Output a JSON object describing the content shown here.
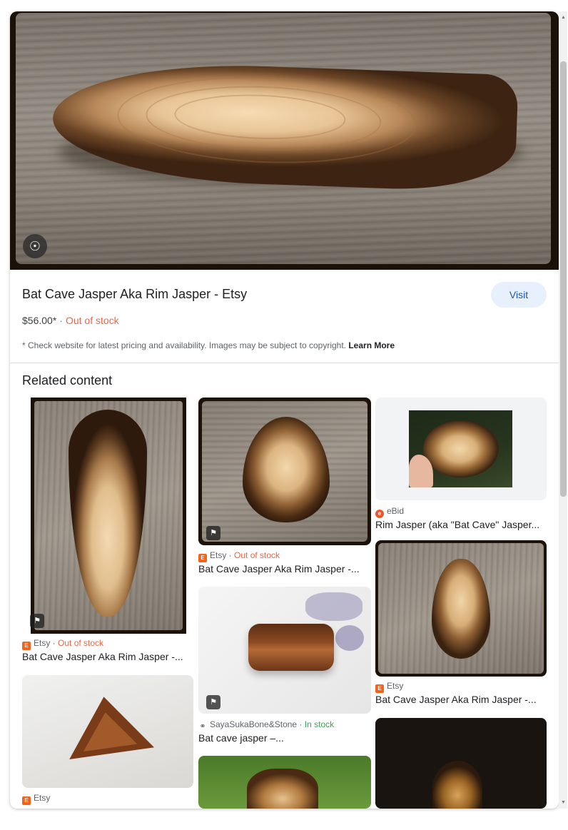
{
  "hero": {
    "lens_icon": "lens-icon",
    "title": "Bat Cave Jasper Aka Rim Jasper - Etsy",
    "visit_label": "Visit",
    "price": "$56.00*",
    "separator": "·",
    "stock": "Out of stock",
    "disclaimer": "* Check website for latest pricing and availability. Images may be subject to copyright.",
    "learn_more": "Learn More"
  },
  "related": {
    "heading": "Related content",
    "cards": [
      {
        "source": "Etsy",
        "sep": " · ",
        "stock": "Out of stock",
        "title": "Bat Cave Jasper Aka Rim Jasper -..."
      },
      {
        "source": "Etsy",
        "sep": " · ",
        "stock": "Out of stock",
        "title": "Bat Cave Jasper Aka Rim Jasper -..."
      },
      {
        "source": "eBid",
        "title": "Rim Jasper (aka \"Bat Cave\" Jasper..."
      },
      {
        "source": "SayaSukaBone&Stone",
        "sep": " · ",
        "stock": "In stock",
        "title": "Bat cave jasper –..."
      },
      {
        "source": "Etsy",
        "title": "Bat Cave Jasper Aka Rim Jasper -..."
      },
      {
        "source": "Etsy",
        "title": ""
      }
    ]
  },
  "colors": {
    "accent_blue": "#1a56b8",
    "visit_bg": "#e8f0fe",
    "out_of_stock": "#e2694b",
    "in_stock": "#34a853",
    "etsy": "#f1641e"
  }
}
